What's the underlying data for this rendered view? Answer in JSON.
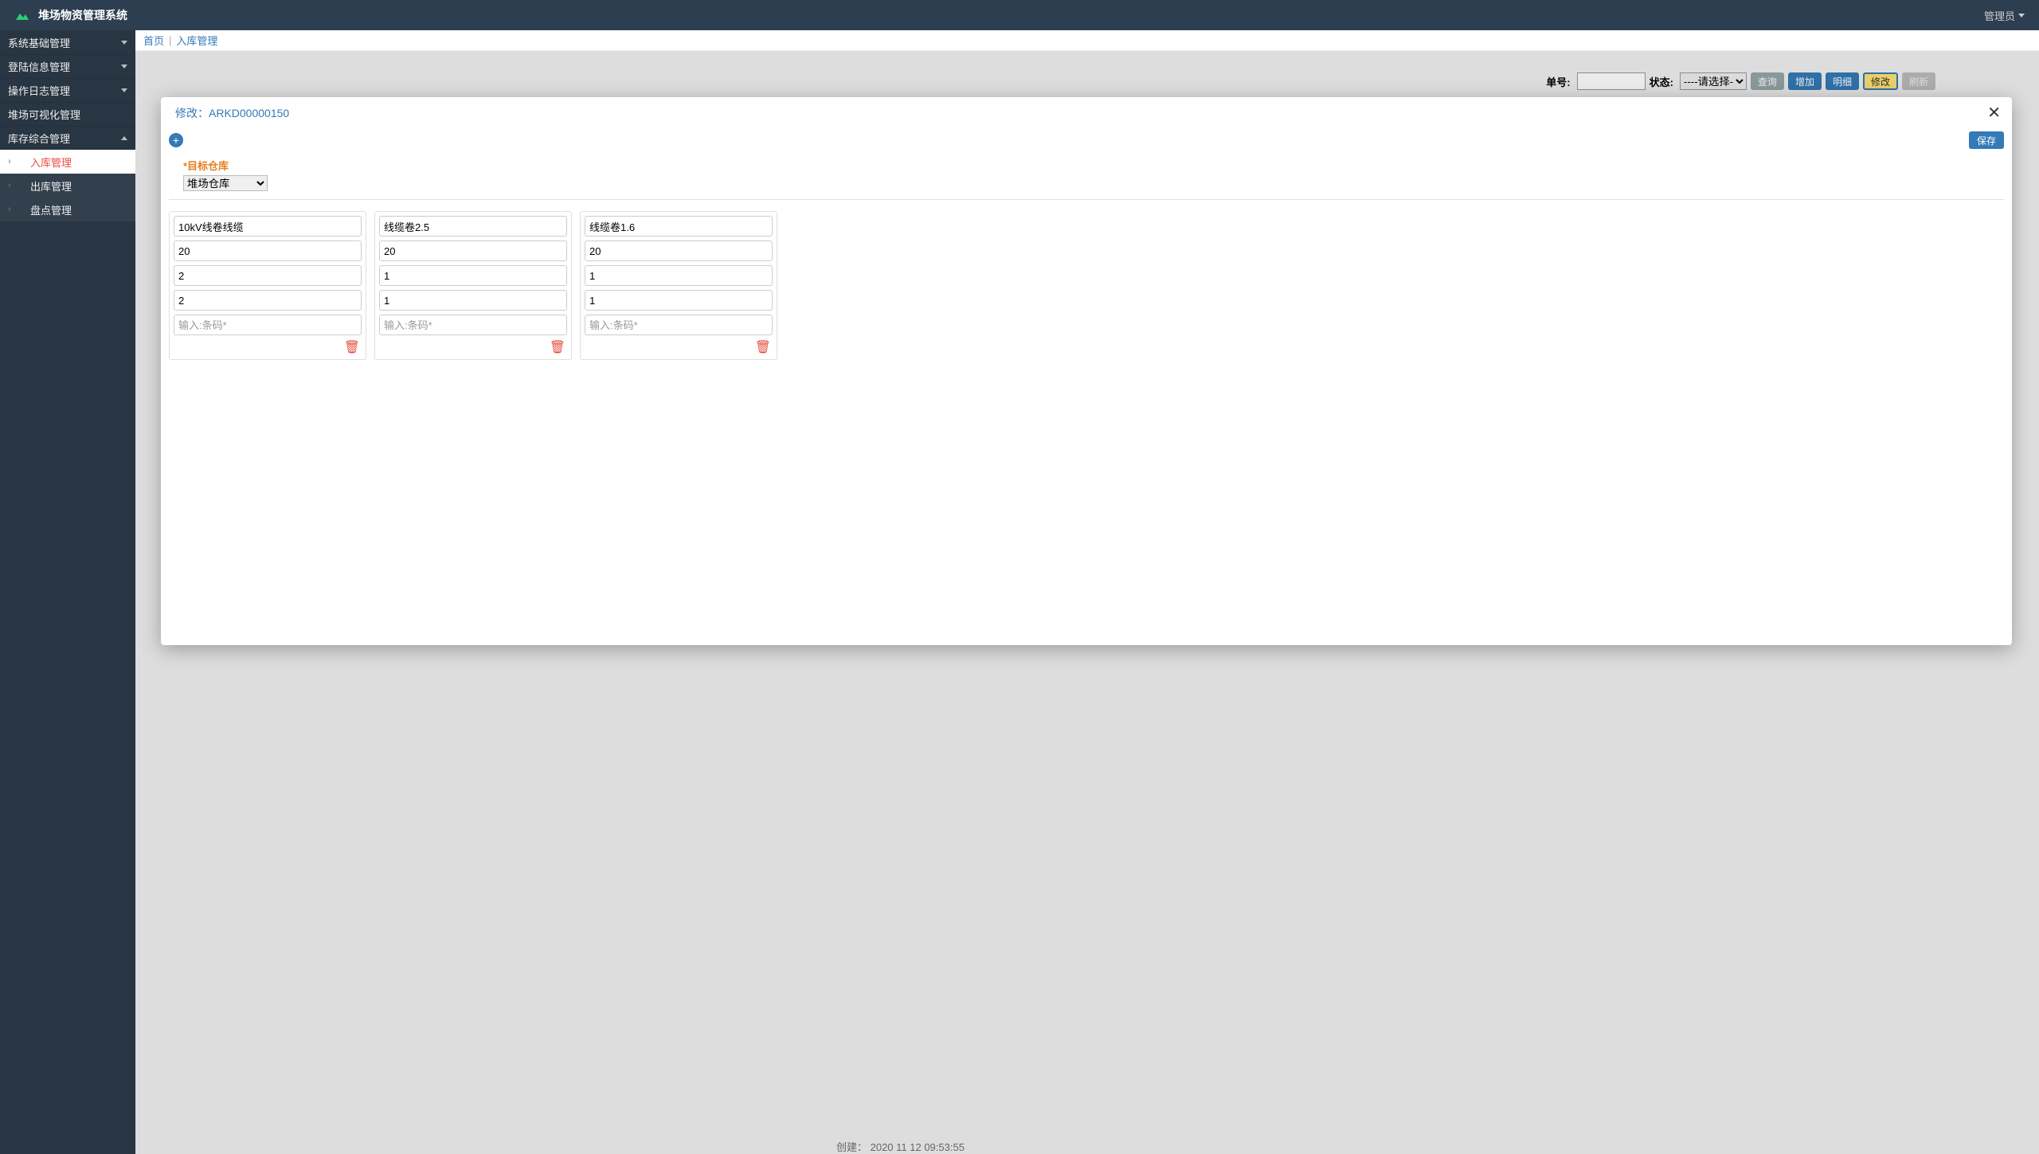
{
  "header": {
    "app_title": "堆场物资管理系统",
    "user_label": "管理员"
  },
  "sidebar": {
    "items": [
      {
        "label": "系统基础管理",
        "kind": "collapsible"
      },
      {
        "label": "登陆信息管理",
        "kind": "collapsible"
      },
      {
        "label": "操作日志管理",
        "kind": "collapsible"
      },
      {
        "label": "堆场可视化管理",
        "kind": "plain"
      },
      {
        "label": "库存综合管理",
        "kind": "expanded"
      }
    ],
    "subitems": [
      {
        "label": "入库管理",
        "active": true
      },
      {
        "label": "出库管理",
        "active": false
      },
      {
        "label": "盘点管理",
        "active": false
      }
    ]
  },
  "breadcrumb": {
    "home": "首页",
    "current": "入库管理"
  },
  "toolbar": {
    "order_label": "单号:",
    "status_label": "状态:",
    "status_placeholder": "----请选择----",
    "btn_query": "查询",
    "btn_add": "增加",
    "btn_detail": "明细",
    "btn_edit": "修改",
    "btn_refresh": "刷新"
  },
  "modal": {
    "title_prefix": "修改：",
    "order_no": "ARKD00000150",
    "save_label": "保存",
    "target_label": "*目标仓库",
    "target_value": "堆场仓库",
    "barcode_placeholder": "输入:条码*",
    "cards": [
      {
        "name": "10kV线卷线缆",
        "qty": "20",
        "v1": "2",
        "v2": "2"
      },
      {
        "name": "线缆卷2.5",
        "qty": "20",
        "v1": "1",
        "v2": "1"
      },
      {
        "name": "线缆卷1.6",
        "qty": "20",
        "v1": "1",
        "v2": "1"
      }
    ]
  },
  "footer_peek": "创建： 2020 11 12 09:53:55"
}
